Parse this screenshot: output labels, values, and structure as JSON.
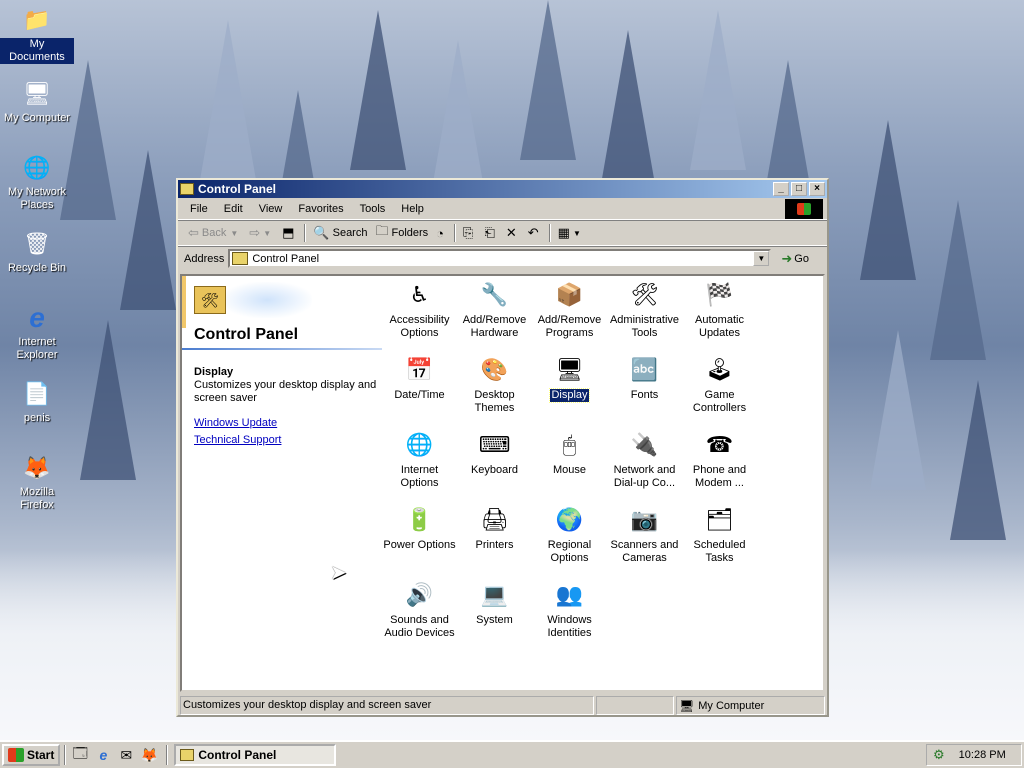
{
  "desktop": {
    "icons": [
      {
        "label": "My Documents",
        "icon": "folder-icon",
        "glyph": "📁"
      },
      {
        "label": "My Computer",
        "icon": "computer-icon",
        "glyph": "🖥"
      },
      {
        "label": "My Network Places",
        "icon": "network-icon",
        "glyph": "🌐"
      },
      {
        "label": "Recycle Bin",
        "icon": "recycle-bin-icon",
        "glyph": "🗑"
      },
      {
        "label": "Internet Explorer",
        "icon": "ie-icon",
        "glyph": "e"
      },
      {
        "label": "penis",
        "icon": "document-icon",
        "glyph": "📄"
      },
      {
        "label": "Mozilla Firefox",
        "icon": "firefox-icon",
        "glyph": "🦊"
      }
    ]
  },
  "window": {
    "title": "Control Panel",
    "menu": [
      "File",
      "Edit",
      "View",
      "Favorites",
      "Tools",
      "Help"
    ],
    "toolbar": {
      "back": "Back",
      "search": "Search",
      "folders": "Folders"
    },
    "address": {
      "label": "Address",
      "value": "Control Panel",
      "go": "Go"
    },
    "left_pane": {
      "title": "Control Panel",
      "selected_name": "Display",
      "selected_desc": "Customizes your desktop display and screen saver",
      "links": [
        "Windows Update",
        "Technical Support"
      ]
    },
    "items": [
      {
        "label": "Accessibility Options",
        "icon": "accessibility-icon",
        "glyph": "♿"
      },
      {
        "label": "Add/Remove Hardware",
        "icon": "hardware-icon",
        "glyph": "🔧"
      },
      {
        "label": "Add/Remove Programs",
        "icon": "programs-icon",
        "glyph": "📦"
      },
      {
        "label": "Administrative Tools",
        "icon": "admin-tools-icon",
        "glyph": "🛠"
      },
      {
        "label": "Automatic Updates",
        "icon": "windows-flag-icon",
        "glyph": "🏁"
      },
      {
        "label": "Date/Time",
        "icon": "calendar-clock-icon",
        "glyph": "📅"
      },
      {
        "label": "Desktop Themes",
        "icon": "themes-icon",
        "glyph": "🎨"
      },
      {
        "label": "Display",
        "icon": "monitor-icon",
        "glyph": "🖥"
      },
      {
        "label": "Fonts",
        "icon": "fonts-icon",
        "glyph": "🔤"
      },
      {
        "label": "Game Controllers",
        "icon": "joystick-icon",
        "glyph": "🕹"
      },
      {
        "label": "Internet Options",
        "icon": "globe-icon",
        "glyph": "🌐"
      },
      {
        "label": "Keyboard",
        "icon": "keyboard-icon",
        "glyph": "⌨"
      },
      {
        "label": "Mouse",
        "icon": "mouse-icon",
        "glyph": "🖱"
      },
      {
        "label": "Network and Dial-up Co...",
        "icon": "network-icon",
        "glyph": "🔌"
      },
      {
        "label": "Phone and Modem ...",
        "icon": "phone-icon",
        "glyph": "☎"
      },
      {
        "label": "Power Options",
        "icon": "power-icon",
        "glyph": "🔋"
      },
      {
        "label": "Printers",
        "icon": "printer-icon",
        "glyph": "🖨"
      },
      {
        "label": "Regional Options",
        "icon": "globe-icon",
        "glyph": "🌍"
      },
      {
        "label": "Scanners and Cameras",
        "icon": "camera-icon",
        "glyph": "📷"
      },
      {
        "label": "Scheduled Tasks",
        "icon": "tasks-icon",
        "glyph": "🗂"
      },
      {
        "label": "Sounds and Audio Devices",
        "icon": "speaker-icon",
        "glyph": "🔊"
      },
      {
        "label": "System",
        "icon": "computer-icon",
        "glyph": "💻"
      },
      {
        "label": "Windows Identities",
        "icon": "users-icon",
        "glyph": "👥"
      }
    ],
    "status": {
      "text": "Customizes your desktop display and screen saver",
      "zone": "My Computer"
    }
  },
  "taskbar": {
    "start": "Start",
    "task": "Control Panel",
    "clock": "10:28 PM"
  }
}
